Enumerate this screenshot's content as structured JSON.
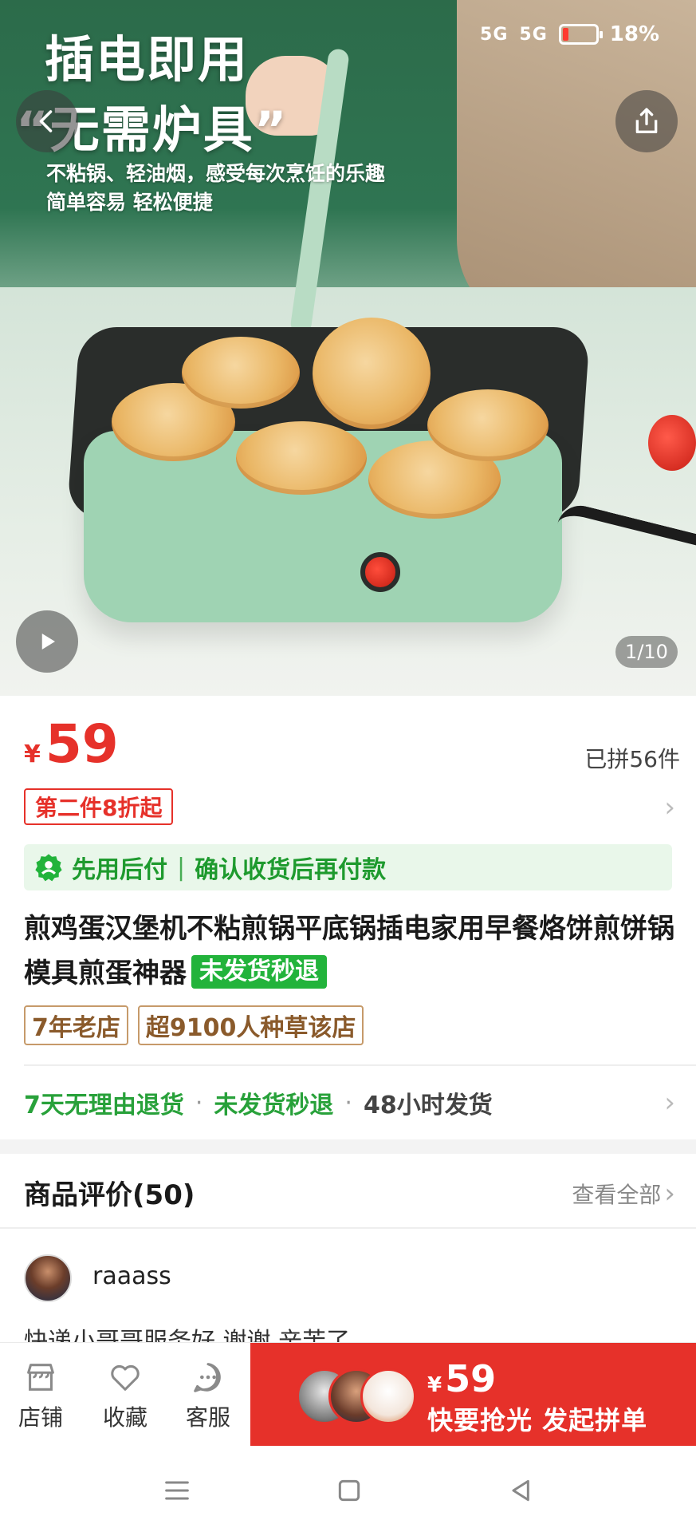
{
  "status_bar": {
    "network1": "5G",
    "network2": "5G",
    "battery_percent": "18%",
    "battery_level": 0.18
  },
  "hero": {
    "headline_line1": "插电即用",
    "headline_line2": "“无需炉具”",
    "subline1": "不粘锅、轻油烟，感受每次烹饪的乐趣",
    "subline2": "简单容易 轻松便捷",
    "page_indicator": "1/10",
    "icons": {
      "back": "back-arrow-icon",
      "share": "share-icon",
      "video": "play-icon"
    }
  },
  "price": {
    "currency": "¥",
    "amount": "59",
    "sold": "已拼56件",
    "promo": "第二件8折起"
  },
  "paylater": {
    "label": "先用后付",
    "detail": "确认收货后再付款",
    "color": "#1e9a2e"
  },
  "product": {
    "title": "煎鸡蛋汉堡机不粘煎锅平底锅插电家用早餐烙饼煎饼锅模具煎蛋神器",
    "title_tag": "未发货秒退"
  },
  "shop_tags": [
    "7年老店",
    "超9100人种草该店"
  ],
  "guarantees": {
    "item1": "7天无理由退货",
    "item2": "未发货秒退",
    "item3": "48小时发货"
  },
  "reviews": {
    "heading": "商品评价(50)",
    "view_all": "查看全部",
    "first": {
      "username": "raaass",
      "text": "快递小哥哥服务好 谢谢 辛苦了"
    }
  },
  "bottom_bar": {
    "store": "店铺",
    "favorite": "收藏",
    "service": "客服",
    "buy_currency": "¥",
    "buy_price": "59",
    "buy_cta": "快要抢光 发起拼单"
  },
  "colors": {
    "accent_red": "#e6312a",
    "green": "#22b33b",
    "shop_tag": "#8a5a2b"
  }
}
